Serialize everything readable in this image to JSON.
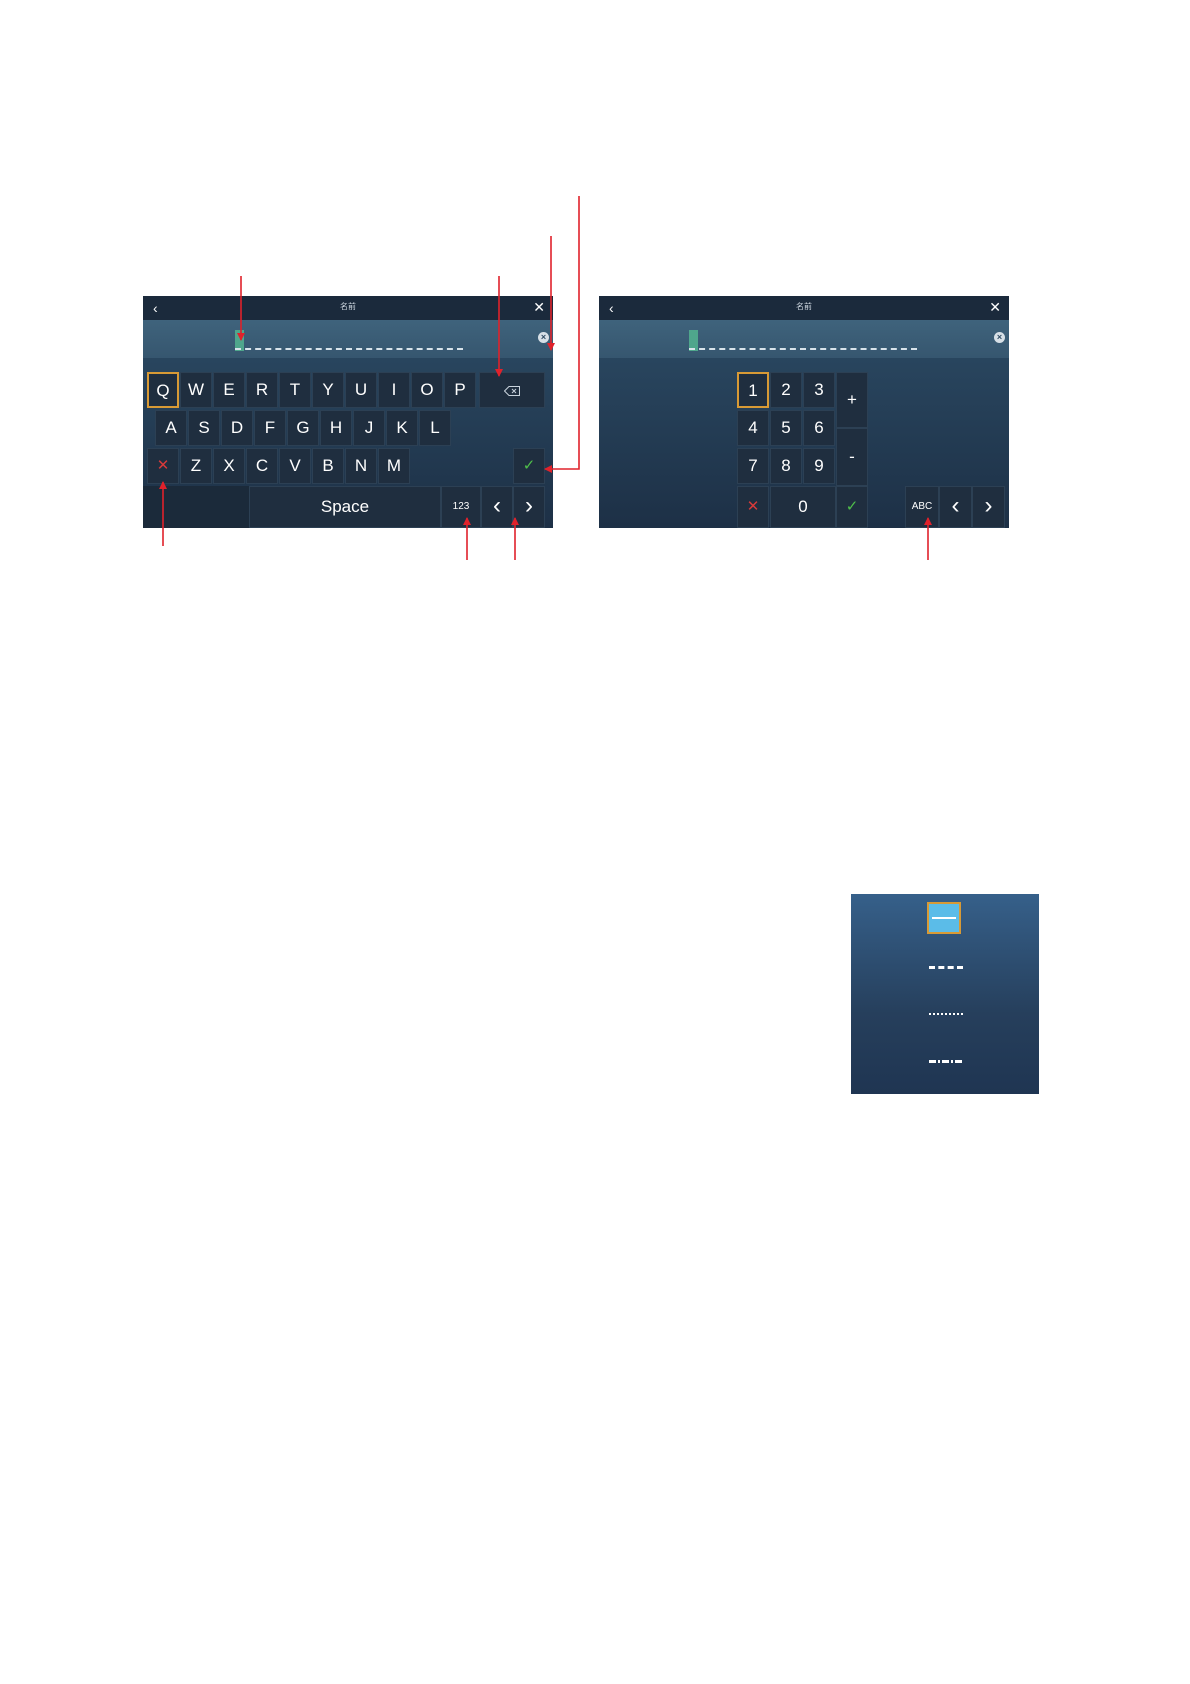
{
  "alpha_screen": {
    "back_icon": "chevron-left-icon",
    "title": "名前",
    "close_icon": "close-icon",
    "clear_icon": "clear-circle-icon",
    "row1": [
      "Q",
      "W",
      "E",
      "R",
      "T",
      "Y",
      "U",
      "I",
      "O",
      "P"
    ],
    "backspace_icon": "backspace-icon",
    "row2": [
      "A",
      "S",
      "D",
      "F",
      "G",
      "H",
      "J",
      "K",
      "L"
    ],
    "cancel_symbol": "✕",
    "row3": [
      "Z",
      "X",
      "C",
      "V",
      "B",
      "N",
      "M"
    ],
    "ok_symbol": "✓",
    "space_label": "Space",
    "mode_label": "123",
    "left_symbol": "‹",
    "right_symbol": "›"
  },
  "num_screen": {
    "back_icon": "chevron-left-icon",
    "title": "名前",
    "close_icon": "close-icon",
    "clear_icon": "clear-circle-icon",
    "keys": [
      "1",
      "2",
      "3",
      "4",
      "5",
      "6",
      "7",
      "8",
      "9"
    ],
    "plus_label": "+",
    "minus_label": "-",
    "cancel_symbol": "✕",
    "zero_label": "0",
    "ok_symbol": "✓",
    "mode_label": "ABC",
    "left_symbol": "‹",
    "right_symbol": "›"
  },
  "colors": {
    "accent_selected": "#d89a35",
    "cancel_red": "#d83a3a",
    "ok_green": "#4fbf4a",
    "annotation_red": "#e0222b",
    "cursor_green": "#4fa68c"
  },
  "line_styles": [
    "solid",
    "dashed",
    "dotted",
    "dash-dot"
  ]
}
